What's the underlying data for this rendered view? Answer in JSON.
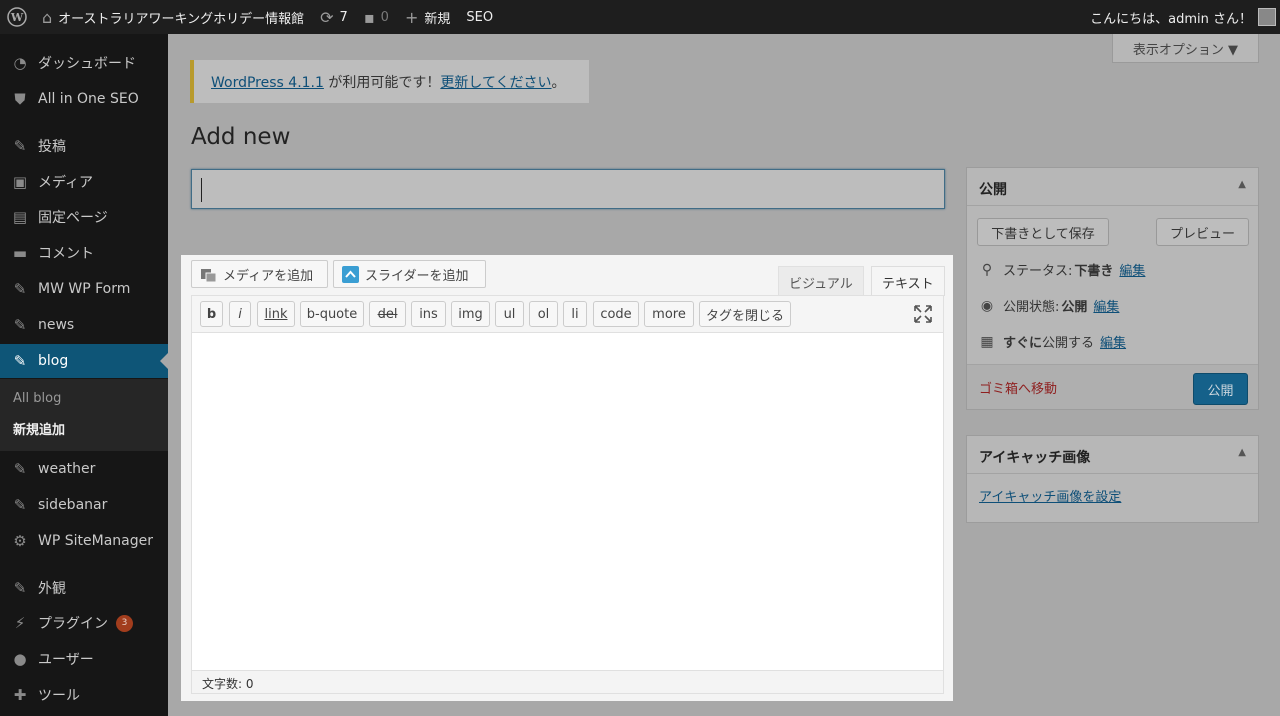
{
  "adminbar": {
    "site_name": "オーストラリアワーキングホリデー情報館",
    "updates_count": "7",
    "comments_count": "0",
    "new_label": "新規",
    "seo_label": "SEO",
    "greeting": "こんにちは、admin さん！"
  },
  "sidebar": {
    "items": [
      {
        "label": "ダッシュボード",
        "icon": "dashboard-icon"
      },
      {
        "label": "All in One SEO",
        "icon": "shield-icon"
      },
      {
        "label": "投稿",
        "icon": "pin-icon"
      },
      {
        "label": "メディア",
        "icon": "media-icon"
      },
      {
        "label": "固定ページ",
        "icon": "page-icon"
      },
      {
        "label": "コメント",
        "icon": "comment-icon"
      },
      {
        "label": "MW WP Form",
        "icon": "pin-icon"
      },
      {
        "label": "news",
        "icon": "pin-icon"
      },
      {
        "label": "blog",
        "icon": "pin-icon"
      },
      {
        "label": "weather",
        "icon": "pin-icon"
      },
      {
        "label": "sidebanar",
        "icon": "pin-icon"
      },
      {
        "label": "WP SiteManager",
        "icon": "gear-icon"
      },
      {
        "label": "外観",
        "icon": "brush-icon"
      },
      {
        "label": "プラグイン",
        "icon": "plugin-icon"
      },
      {
        "label": "ユーザー",
        "icon": "user-icon"
      },
      {
        "label": "ツール",
        "icon": "wrench-icon"
      }
    ],
    "submenu": {
      "all": "All blog",
      "new": "新規追加"
    },
    "plugin_badge": "3"
  },
  "screen_options": "表示オプション ▼",
  "notice": {
    "version_link": "WordPress 4.1.1",
    "middle": " が利用可能です！",
    "update_link": "更新してください",
    "end": "。"
  },
  "page_title": "Add new",
  "editor": {
    "add_media": "メディアを追加",
    "add_slider": "スライダーを追加",
    "tab_visual": "ビジュアル",
    "tab_text": "テキスト",
    "quicktags": [
      "b",
      "i",
      "link",
      "b-quote",
      "del",
      "ins",
      "img",
      "ul",
      "ol",
      "li",
      "code",
      "more",
      "タグを閉じる"
    ],
    "word_count_label": "文字数: 0"
  },
  "publish_box": {
    "title": "公開",
    "save_draft": "下書きとして保存",
    "preview": "プレビュー",
    "status_label": "ステータス:",
    "status_value": "下書き",
    "visibility_label": "公開状態:",
    "visibility_value": "公開",
    "schedule_label": "すぐに",
    "schedule_value": "公開する",
    "edit": "編集",
    "trash": "ゴミ箱へ移動",
    "publish": "公開"
  },
  "thumbnail_box": {
    "title": "アイキャッチ画像",
    "set_link": "アイキャッチ画像を設定"
  },
  "colors": {
    "accent": "#0073aa",
    "sidebar_bg": "#161616",
    "adminbar_bg": "#1e1e1e"
  }
}
